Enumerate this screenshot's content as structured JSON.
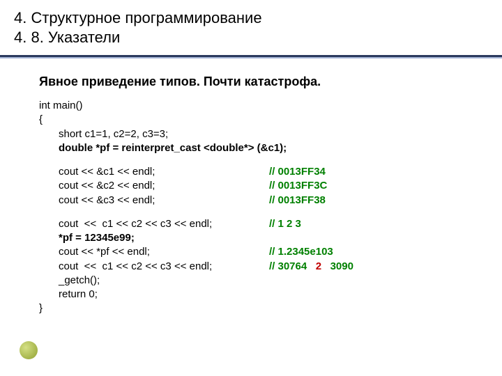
{
  "header": {
    "line1": "4. Структурное программирование",
    "line2": "4. 8. Указатели"
  },
  "subtitle": "Явное приведение типов. Почти катастрофа.",
  "code": {
    "l1": "int main()",
    "l2": "{",
    "l3": "short c1=1, c2=2, c3=3;",
    "l4": "double *pf = reinterpret_cast <double*> (&c1);",
    "b1l": "cout << &c1 << endl;",
    "b1r": "// 0013FF34",
    "b2l": "cout << &c2 << endl;",
    "b2r": "// 0013FF3C",
    "b3l": "cout << &c3 << endl;",
    "b3r": "// 0013FF38",
    "c1l": "cout  <<  c1 << c2 << c3 << endl;",
    "c1r": "// 1 2 3",
    "c2": "*pf = 12345e99;",
    "c3l": "cout << *pf << endl;",
    "c3r": "// 1.2345e103",
    "c4l": "cout  <<  c1 << c2 << c3 << endl;",
    "c4r_a": "// 30764",
    "c4r_b": "2",
    "c4r_c": "3090",
    "c5": "_getch();",
    "c6": "return 0;",
    "l_end": "}"
  }
}
